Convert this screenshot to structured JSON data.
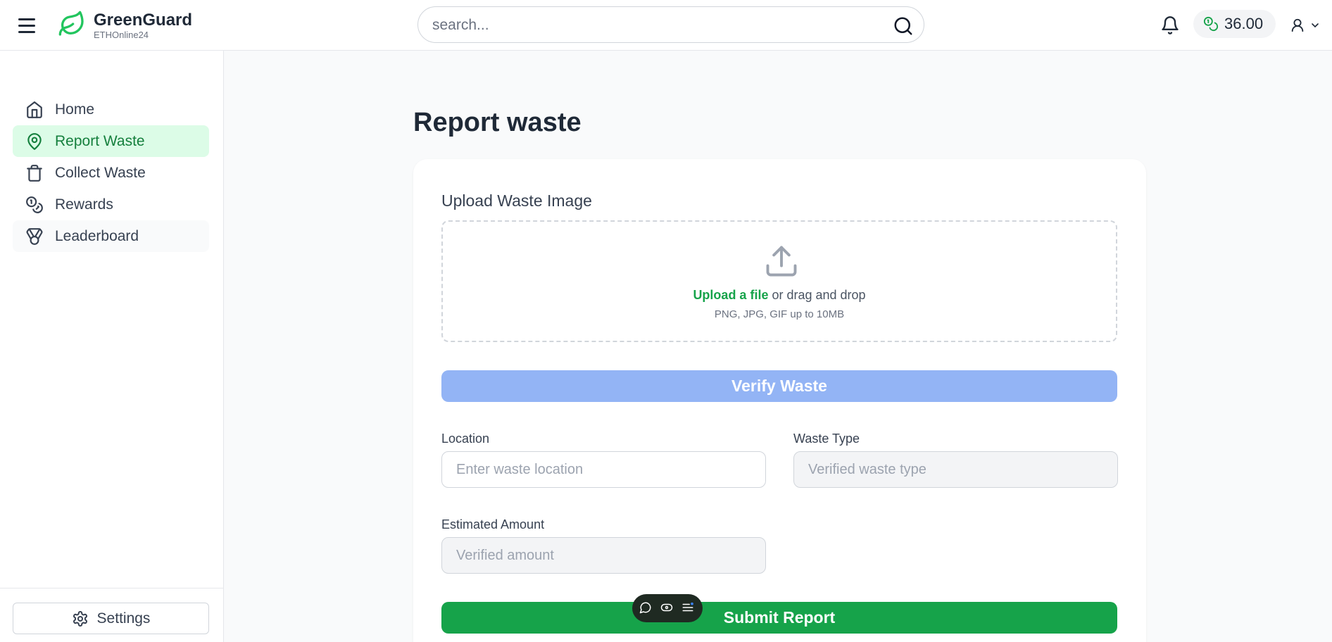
{
  "header": {
    "brand_name": "GreenGuard",
    "brand_sub": "ETHOnline24",
    "search_placeholder": "search...",
    "balance": "36.00"
  },
  "sidebar": {
    "items": [
      {
        "label": "Home",
        "icon": "home-icon"
      },
      {
        "label": "Report Waste",
        "icon": "map-pin-icon",
        "active": true
      },
      {
        "label": "Collect Waste",
        "icon": "trash-icon"
      },
      {
        "label": "Rewards",
        "icon": "coins-icon"
      },
      {
        "label": "Leaderboard",
        "icon": "medal-icon"
      }
    ],
    "settings_label": "Settings"
  },
  "main": {
    "title": "Report waste",
    "upload_label": "Upload Waste Image",
    "upload_link": "Upload a file",
    "upload_text": "or drag and drop",
    "upload_hint": "PNG, JPG, GIF up to 10MB",
    "verify_label": "Verify Waste",
    "location_label": "Location",
    "location_placeholder": "Enter waste location",
    "waste_type_label": "Waste Type",
    "waste_type_placeholder": "Verified waste type",
    "amount_label": "Estimated Amount",
    "amount_placeholder": "Verified amount",
    "submit_label": "Submit Report"
  },
  "colors": {
    "accent_green": "#16a34a",
    "active_bg": "#dcfce7",
    "verify_blue": "#93b4f5"
  }
}
